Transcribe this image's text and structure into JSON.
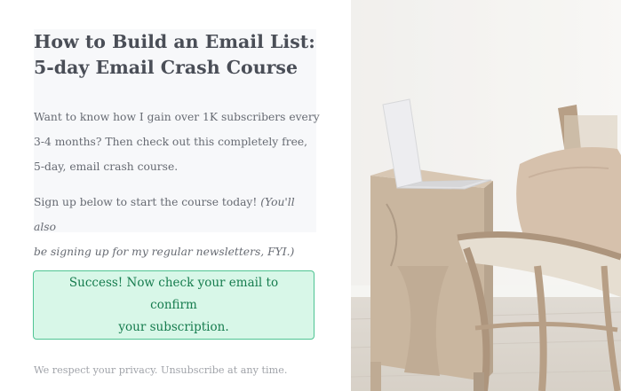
{
  "headline": {
    "line1": "How to Build an Email List:",
    "line2": "5-day Email Crash Course"
  },
  "intro": {
    "line1": "Want to know how I gain over 1K subscribers every",
    "line2": "3-4 months? Then check out this completely free,",
    "line3": "5-day, email crash course."
  },
  "cta": {
    "line1_plain": "Sign up below to start the course today! ",
    "line1_italic": "(You'll also",
    "line2_italic": "be signing up for my regular newsletters, FYI.)"
  },
  "success": {
    "line1": "Success! Now check your email to confirm",
    "line2": "your subscription."
  },
  "privacy_note": "We respect your privacy. Unsubscribe at any time.",
  "colors": {
    "success_background": "#d8f7e8",
    "success_border": "#4fc493",
    "success_text": "#167c4e"
  },
  "image": {
    "subject": "laptop-on-wooden-stool-and-rattan-chair-photo"
  }
}
